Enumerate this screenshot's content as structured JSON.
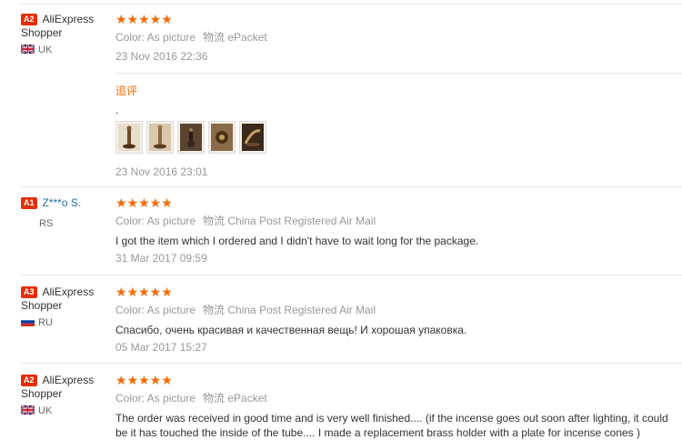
{
  "reviews": [
    {
      "badge": "A2",
      "name_line1": "AliExpress",
      "name_line2": "Shopper",
      "country": "UK",
      "flag": "uk-flag-icon",
      "stars": "★★★★★",
      "color": "Color: As picture",
      "shipping": "物流 ePacket",
      "text": "",
      "date": "23 Nov 2016 22:36",
      "followup": {
        "label": "追评",
        "text": ".",
        "date": "23 Nov 2016 23:01",
        "photos": [
          "incense-holder-photo-1",
          "incense-holder-photo-2",
          "incense-holder-photo-3",
          "incense-holder-photo-4",
          "incense-holder-photo-5"
        ]
      }
    },
    {
      "badge": "A1",
      "name_line1": "Z***o S.",
      "name_line2": "",
      "country": "RS",
      "flag": "",
      "stars": "★★★★★",
      "color": "Color: As picture",
      "shipping": "物流 China Post Registered Air Mail",
      "text": "I got the item which I ordered and I didn't have to wait long for the package.",
      "date": "31 Mar 2017 09:59"
    },
    {
      "badge": "A3",
      "name_line1": "AliExpress",
      "name_line2": "Shopper",
      "country": "RU",
      "flag": "ru-flag-icon",
      "stars": "★★★★★",
      "color": "Color: As picture",
      "shipping": "物流 China Post Registered Air Mail",
      "text": "Спасибо, очень красивая и качественная вещь! И хорошая упаковка.",
      "date": "05 Mar 2017 15:27"
    },
    {
      "badge": "A2",
      "name_line1": "AliExpress",
      "name_line2": "Shopper",
      "country": "UK",
      "flag": "uk-flag-icon",
      "stars": "★★★★★",
      "color": "Color: As picture",
      "shipping": "物流 ePacket",
      "text": "The order was received in good time and is very well finished.... (if the incense goes out soon after lighting, it could be it has touched the inside of the tube.... I made a replacement brass holder with a plate for incense cones )",
      "date": ""
    }
  ],
  "colors": {
    "badge": "#e62e04",
    "stars": "#f56a00",
    "link": "#2b6ab3",
    "meta": "#999999"
  }
}
